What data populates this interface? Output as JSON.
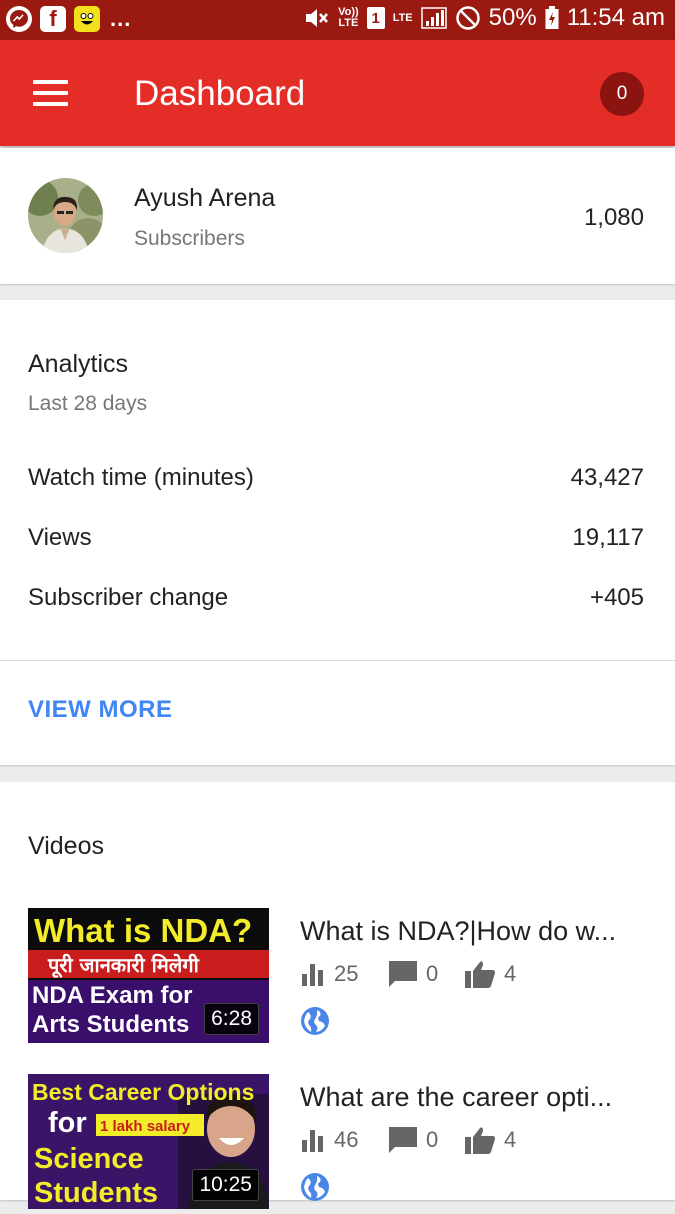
{
  "status_bar": {
    "fb_label": "f",
    "more": "...",
    "volte_top": "Vo))",
    "volte_bottom": "LTE",
    "sim": "1",
    "lte": "LTE",
    "battery": "50%",
    "time": "11:54 am"
  },
  "app_bar": {
    "title": "Dashboard",
    "notification_count": "0"
  },
  "channel": {
    "name": "Ayush Arena",
    "subscribers_label": "Subscribers",
    "subscribers_count": "1,080"
  },
  "analytics": {
    "title": "Analytics",
    "period": "Last 28 days",
    "metrics": [
      {
        "label": "Watch time (minutes)",
        "value": "43,427"
      },
      {
        "label": "Views",
        "value": "19,117"
      },
      {
        "label": "Subscriber change",
        "value": "+405"
      }
    ],
    "view_more": "VIEW MORE"
  },
  "videos": {
    "title": "Videos",
    "items": [
      {
        "title": "What is NDA?|How do w...",
        "views": "25",
        "comments": "0",
        "likes": "4",
        "duration": "6:28",
        "thumb": {
          "line1": "What is NDA?",
          "line2": "पूरी जानकारी मिलेगी",
          "line3": "NDA Exam for",
          "line4": "Arts Students"
        }
      },
      {
        "title": "What are the career opti...",
        "views": "46",
        "comments": "0",
        "likes": "4",
        "duration": "10:25",
        "thumb": {
          "line1": "Best Career Options",
          "line2": "for",
          "badge": "1 lakh salary",
          "line3": "Science",
          "line4": "Students"
        }
      }
    ]
  },
  "colors": {
    "app_bar": "#e52d27",
    "status_bar": "#9a1a12",
    "link": "#4285f4",
    "globe": "#4a86e8"
  },
  "icons": [
    "menu-icon",
    "bar-chart-icon",
    "comment-icon",
    "thumbs-up-icon",
    "globe-icon"
  ]
}
